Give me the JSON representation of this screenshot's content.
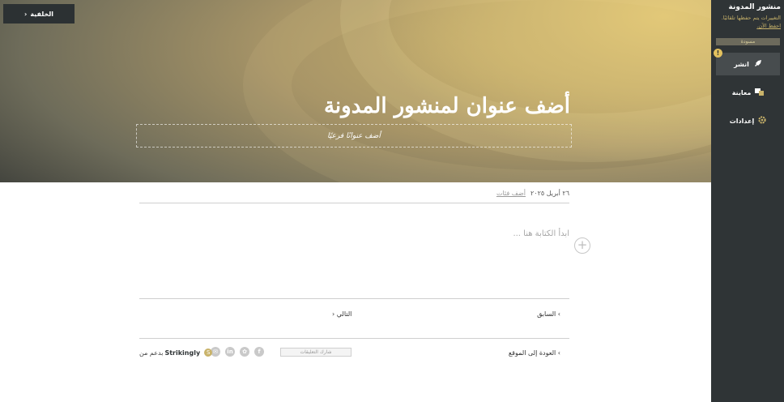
{
  "hero": {
    "background_button": "الخلفية",
    "title": "أضف عنوان لمنشور المدونة",
    "subtitle_placeholder": "أضف عنوانًا فرعيًا"
  },
  "sidebar": {
    "title": "منشور المدونة",
    "note": "التغييرات يتم حفظها تلقائيًا.",
    "save_now": "احفظ الآن.",
    "draft_badge": "مسودة",
    "publish": "انشر",
    "preview": "معاينة",
    "settings": "إعدادات"
  },
  "post": {
    "date": "٢٦ أبريل ٢٠٢٥",
    "add_category": "أضف فئات",
    "write_placeholder": "ابدأ الكتابة هنا ..."
  },
  "nav": {
    "previous": "السابق",
    "next": "التالي",
    "back_to_site": "العودة إلى الموقع"
  },
  "footer": {
    "comment_button": "شارك التعليقات",
    "powered_by_prefix": "بدعم من",
    "brand": "Strikingly"
  },
  "colors": {
    "sidebar_bg": "#2f3436",
    "accent_gold": "#c9b36a",
    "hero_gold": "#e2c878"
  }
}
